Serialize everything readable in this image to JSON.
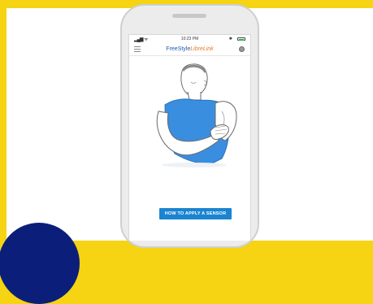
{
  "status_bar": {
    "time": "10:23 PM",
    "signal_glyph": "▂▄▆",
    "wifi_glyph": "ᯤ",
    "bluetooth_glyph": "✱",
    "battery_level": 1.0
  },
  "app": {
    "brand_first": "FreeStyle",
    "brand_second": "LibreLink"
  },
  "main": {
    "button_label": "HOW TO APPLY A SENSOR"
  },
  "icons": [
    "signal-icon",
    "wifi-icon",
    "bluetooth-icon",
    "battery-icon",
    "menu-icon",
    "sensor-icon"
  ],
  "colors": {
    "background": "#f6d313",
    "button": "#1b84d1",
    "brand_blue": "#1a5eab",
    "brand_orange": "#e87722",
    "shirt": "#3a8ee0",
    "corner_blob": "#0b1f7a"
  }
}
